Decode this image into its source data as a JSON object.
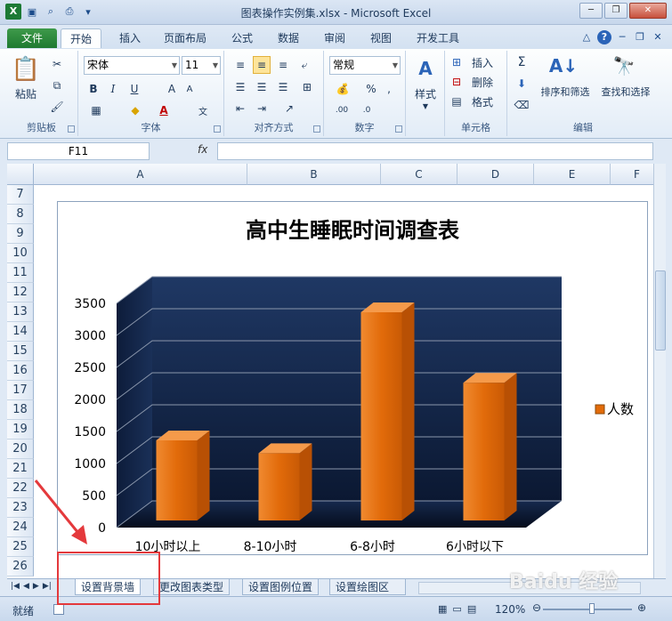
{
  "window": {
    "title": "图表操作实例集.xlsx - Microsoft Excel"
  },
  "ribbon_tabs": [
    "文件",
    "开始",
    "插入",
    "页面布局",
    "公式",
    "数据",
    "审阅",
    "视图",
    "开发工具"
  ],
  "ribbon": {
    "clipboard": {
      "label": "剪贴板",
      "paste": "粘贴"
    },
    "font": {
      "label": "字体",
      "name": "宋体",
      "size": "11"
    },
    "alignment": {
      "label": "对齐方式"
    },
    "number": {
      "label": "数字",
      "format": "常规"
    },
    "styles": {
      "label": "样式"
    },
    "cells": {
      "label": "单元格",
      "insert": "插入",
      "delete": "删除",
      "format": "格式"
    },
    "editing": {
      "label": "编辑",
      "sort": "排序和筛选",
      "find": "查找和选择"
    }
  },
  "formula_bar": {
    "name_box": "F11",
    "fx": "fx"
  },
  "columns": [
    "A",
    "B",
    "C",
    "D",
    "E",
    "F"
  ],
  "rows": [
    "7",
    "8",
    "9",
    "10",
    "11",
    "12",
    "13",
    "14",
    "15",
    "16",
    "17",
    "18",
    "19",
    "20",
    "21",
    "22",
    "23",
    "24",
    "25",
    "26"
  ],
  "chart_data": {
    "type": "bar",
    "title": "高中生睡眠时间调查表",
    "categories": [
      "10小时以上",
      "8-10小时",
      "6-8小时",
      "6小时以下"
    ],
    "series": [
      {
        "name": "人数",
        "values": [
          1250,
          1050,
          3250,
          2150
        ]
      }
    ],
    "ylim": [
      0,
      3500
    ],
    "yticks": [
      "0",
      "500",
      "1000",
      "1500",
      "2000",
      "2500",
      "3000",
      "3500"
    ],
    "legend": "right",
    "grid": true,
    "colors": {
      "bar": "#e26b0a",
      "wall": "#1f3864"
    }
  },
  "sheet_tabs": [
    "设置背景墙",
    "更改图表类型",
    "设置图例位置",
    "设置绘图区"
  ],
  "status": {
    "ready": "就绪",
    "zoom": "120%"
  },
  "watermark": "Baidu 经验"
}
